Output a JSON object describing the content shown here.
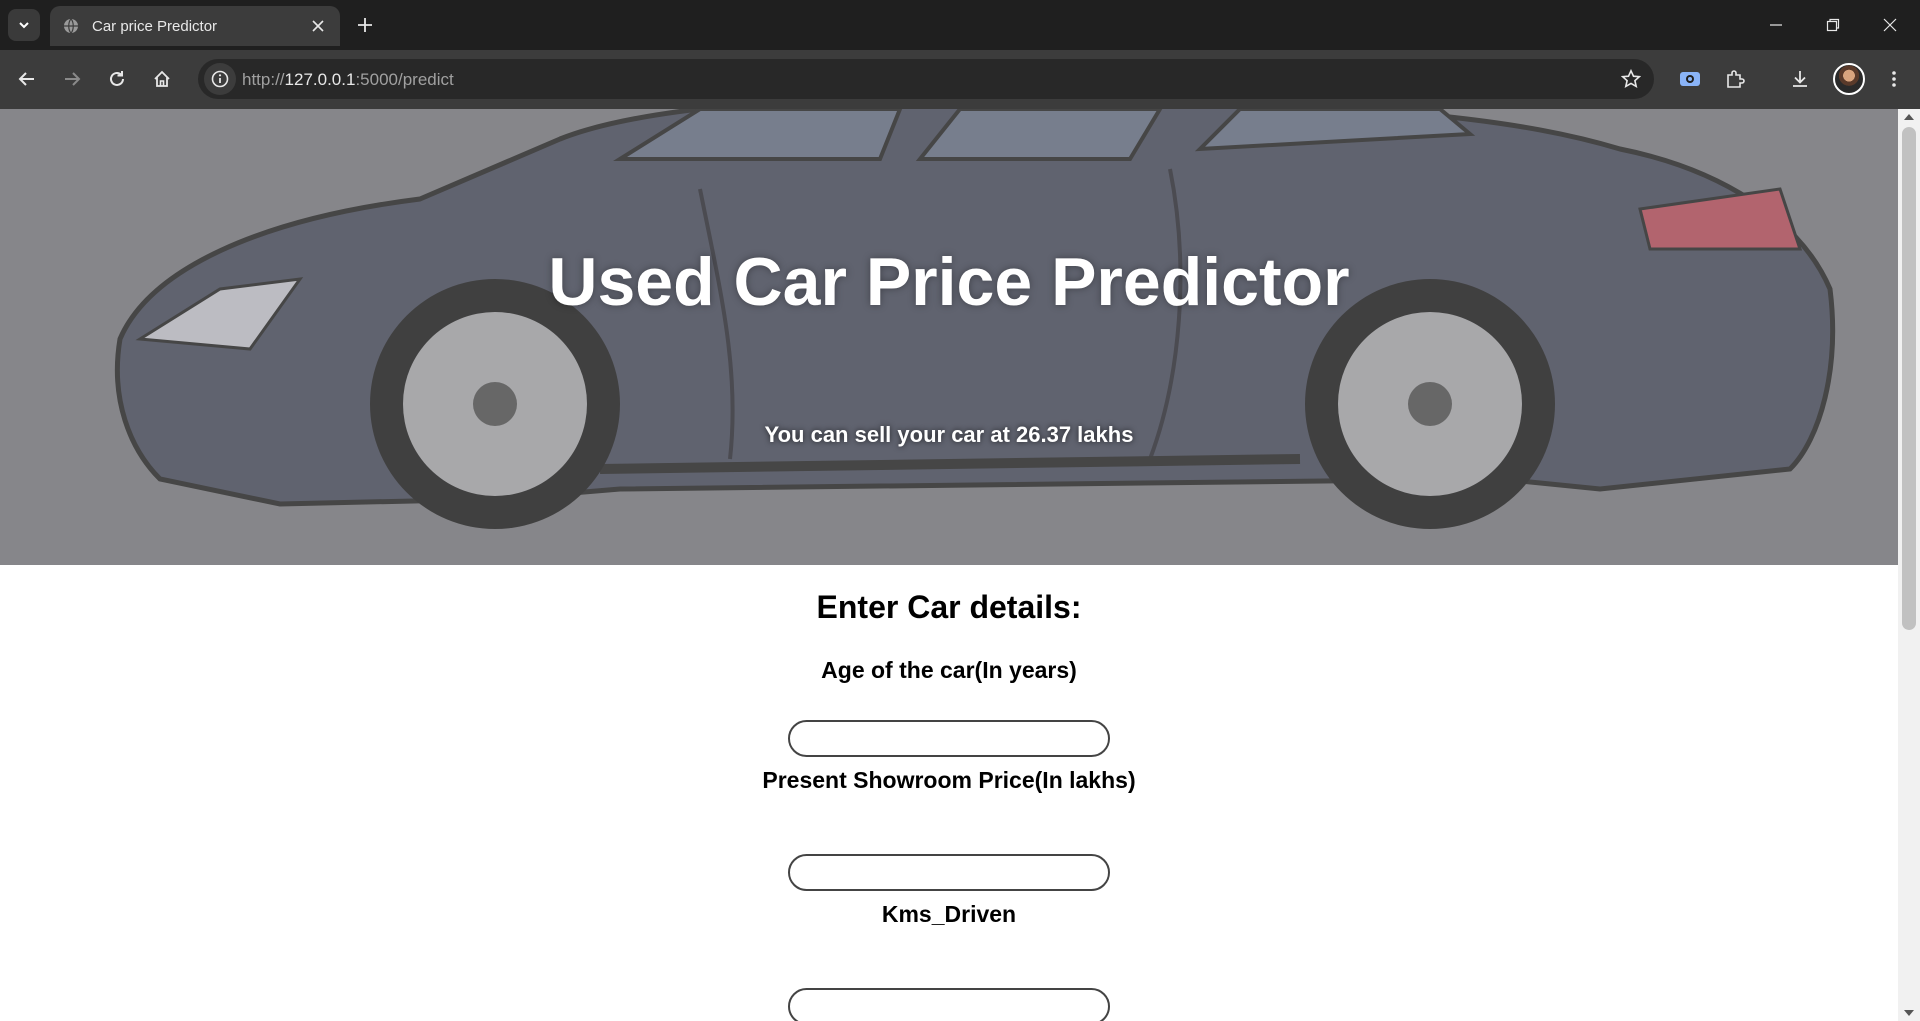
{
  "browser": {
    "tab_title": "Car price Predictor",
    "url_scheme": "http://",
    "url_host": "127.0.0.1",
    "url_path": ":5000/predict"
  },
  "page": {
    "title": "Used Car Price Predictor",
    "result": "You can sell your car at 26.37 lakhs",
    "form_title": "Enter Car details:",
    "fields": [
      {
        "label": "Age of the car(In years)",
        "value": ""
      },
      {
        "label": "Present Showroom Price(In lakhs)",
        "value": ""
      },
      {
        "label": "Kms_Driven",
        "value": ""
      }
    ]
  },
  "colors": {
    "hero_overlay": "#7a7a7f",
    "car_body": "#4b4f62",
    "text_on_hero": "#ffffff"
  }
}
